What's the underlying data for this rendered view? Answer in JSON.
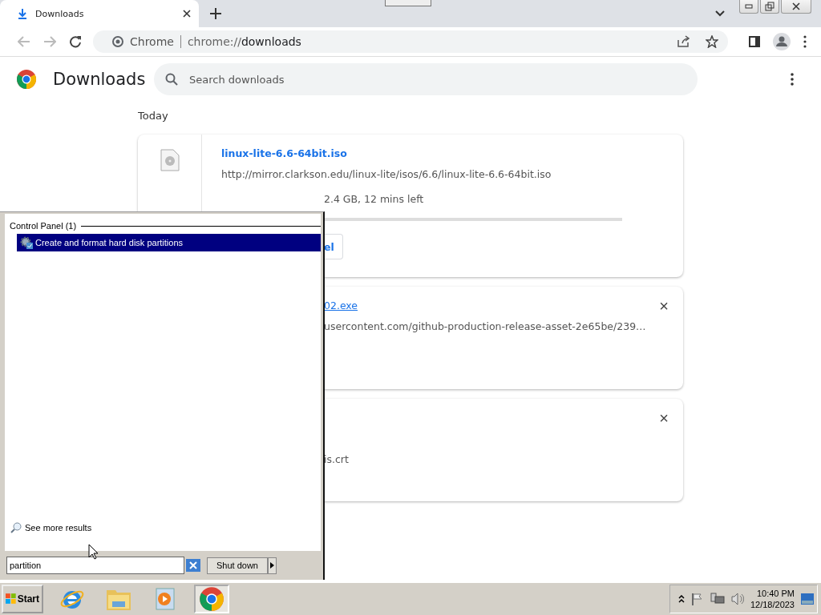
{
  "browser": {
    "tab": {
      "title": "Downloads",
      "selected": true
    },
    "address": {
      "site": "Chrome",
      "url_prefix": "chrome://",
      "url_path": "downloads"
    }
  },
  "page": {
    "title": "Downloads",
    "search": {
      "placeholder": "Search downloads"
    },
    "section": "Today",
    "downloads": [
      {
        "kind": "in_progress",
        "name": "linux-lite-6.6-64bit.iso",
        "url": "http://mirror.clarkson.edu/linux-lite/isos/6.6/linux-lite-6.6-64bit.iso",
        "status": "2.4 GB, 12 mins left",
        "action": "el"
      },
      {
        "kind": "covered",
        "name": "02.exe",
        "url": "usercontent.com/github-production-release-asset-2e65be/239…",
        "remove": "×"
      },
      {
        "kind": "covered",
        "url": "is.crt",
        "remove": "×"
      }
    ]
  },
  "start_menu": {
    "group": "Control Panel (1)",
    "results": [
      {
        "label": "Create and format hard disk partitions",
        "selected": true
      }
    ],
    "more": "See more results",
    "search_value": "partition",
    "shutdown": "Shut down"
  },
  "taskbar": {
    "start": "Start",
    "apps": [
      {
        "kind": "ie",
        "active": false
      },
      {
        "kind": "folder",
        "active": false
      },
      {
        "kind": "media",
        "active": false
      },
      {
        "kind": "chrome",
        "active": true
      }
    ],
    "time": "10:40 PM",
    "date": "12/18/2023"
  }
}
